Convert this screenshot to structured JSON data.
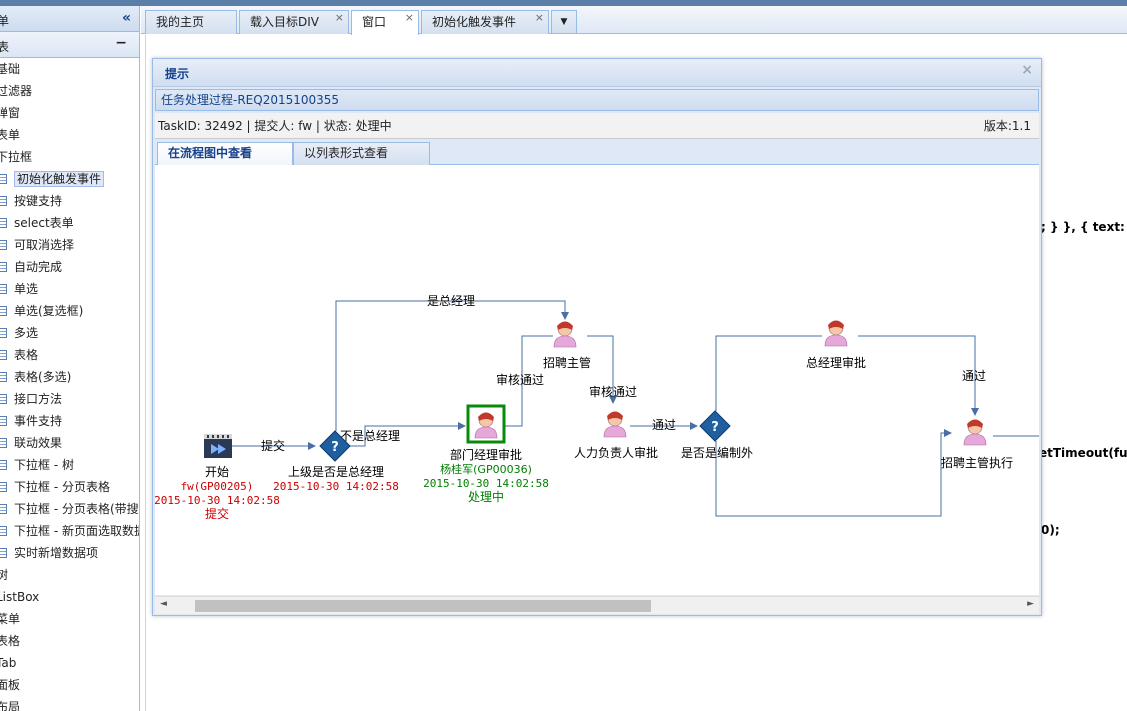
{
  "sidebar": {
    "header": "单",
    "collapse_icon": "«",
    "sub_header": "表",
    "sub_toggle": "−",
    "items": [
      {
        "label": "基础",
        "level": 0
      },
      {
        "label": "过滤器",
        "level": 0
      },
      {
        "label": "弹窗",
        "level": 0
      },
      {
        "label": "表单",
        "level": 0
      },
      {
        "label": "下拉框",
        "level": 0
      },
      {
        "label": "初始化触发事件",
        "level": 1,
        "selected": true
      },
      {
        "label": "按键支持",
        "level": 1
      },
      {
        "label": "select表单",
        "level": 1
      },
      {
        "label": "可取消选择",
        "level": 1
      },
      {
        "label": "自动完成",
        "level": 1
      },
      {
        "label": "单选",
        "level": 1
      },
      {
        "label": "单选(复选框)",
        "level": 1
      },
      {
        "label": "多选",
        "level": 1
      },
      {
        "label": "表格",
        "level": 1
      },
      {
        "label": "表格(多选)",
        "level": 1
      },
      {
        "label": "接口方法",
        "level": 1
      },
      {
        "label": "事件支持",
        "level": 1
      },
      {
        "label": "联动效果",
        "level": 1
      },
      {
        "label": "下拉框 - 树",
        "level": 1
      },
      {
        "label": "下拉框 - 分页表格",
        "level": 1
      },
      {
        "label": "下拉框 - 分页表格(带搜",
        "level": 1
      },
      {
        "label": "下拉框 - 新页面选取数据",
        "level": 1
      },
      {
        "label": "实时新增数据项",
        "level": 1
      },
      {
        "label": "树",
        "level": 0
      },
      {
        "label": "ListBox",
        "level": 0
      },
      {
        "label": "菜单",
        "level": 0
      },
      {
        "label": "表格",
        "level": 0
      },
      {
        "label": "Tab",
        "level": 0
      },
      {
        "label": "面板",
        "level": 0
      },
      {
        "label": "布局",
        "level": 0
      }
    ]
  },
  "tabs": [
    {
      "label": "我的主页",
      "closable": false
    },
    {
      "label": "载入目标DIV",
      "closable": true
    },
    {
      "label": "窗口",
      "closable": true,
      "active": true
    },
    {
      "label": "初始化触发事件",
      "closable": true
    }
  ],
  "tab_close": "×",
  "tab_dropdown": "▼",
  "background_code": [
    "; } }, { text: '取",
    "etTimeout(func",
    "0);"
  ],
  "dialog": {
    "title": "提示",
    "close": "×",
    "process_title": "任务处理过程-REQ2015100355",
    "info": "TaskID: 32492 | 提交人: fw | 状态: 处理中",
    "version": "版本:1.1",
    "subtabs": [
      "在流程图中查看",
      "以列表形式查看"
    ],
    "scroll_left": "◄",
    "scroll_right": "►"
  },
  "flow": {
    "nodes": {
      "start": {
        "label": "开始",
        "user": "fw(GP00205)",
        "time": "2015-10-30 14:02:58",
        "status": "提交"
      },
      "gate1": {
        "label": "上级是否是总经理",
        "time": "2015-10-30 14:02:58"
      },
      "dept": {
        "label": "部门经理审批",
        "user": "杨桂军(GP00036)",
        "time": "2015-10-30 14:02:58",
        "status": "处理中"
      },
      "recruit": {
        "label": "招聘主管"
      },
      "hr": {
        "label": "人力负责人审批"
      },
      "gate2": {
        "label": "是否是编制外"
      },
      "gm": {
        "label": "总经理审批"
      },
      "exec": {
        "label": "招聘主管执行"
      }
    },
    "edges": {
      "submit": "提交",
      "is_gm": "是总经理",
      "not_gm": "不是总经理",
      "review1": "审核通过",
      "review2": "审核通过",
      "pass1": "通过",
      "pass2": "通过"
    },
    "colors": {
      "line": "#4a6fa5",
      "red": "#cc0000",
      "green": "#008000"
    }
  }
}
